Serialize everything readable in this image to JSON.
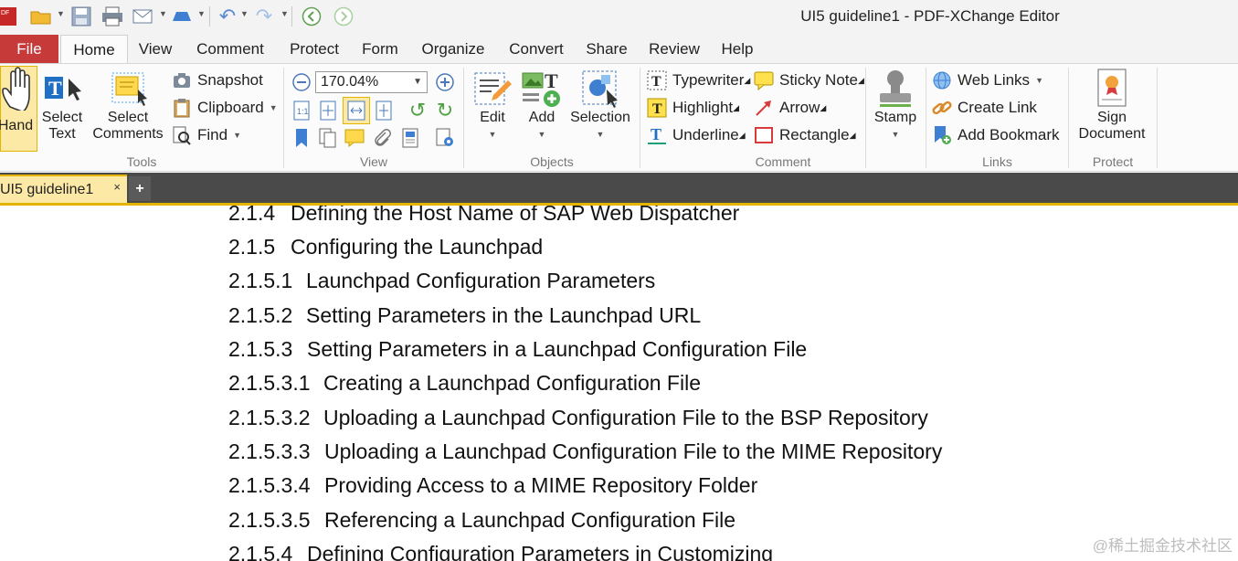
{
  "titlebar": {
    "title": "UI5 guideline1 - PDF-XChange Editor",
    "app_icon_text": "DF"
  },
  "tabs": [
    {
      "label": "File"
    },
    {
      "label": "Home"
    },
    {
      "label": "View"
    },
    {
      "label": "Comment"
    },
    {
      "label": "Protect"
    },
    {
      "label": "Form"
    },
    {
      "label": "Organize"
    },
    {
      "label": "Convert"
    },
    {
      "label": "Share"
    },
    {
      "label": "Review"
    },
    {
      "label": "Help"
    }
  ],
  "tools": {
    "hand": "Hand",
    "select_text_1": "Select",
    "select_text_2": "Text",
    "select_comments_1": "Select",
    "select_comments_2": "Comments",
    "snapshot": "Snapshot",
    "clipboard": "Clipboard",
    "find": "Find",
    "label": "Tools"
  },
  "view": {
    "zoom": "170.04%",
    "label": "View"
  },
  "objects": {
    "edit": "Edit",
    "add": "Add",
    "selection": "Selection",
    "label": "Objects"
  },
  "comment": {
    "typewriter": "Typewriter",
    "sticky_note": "Sticky Note",
    "highlight": "Highlight",
    "arrow": "Arrow",
    "underline": "Underline",
    "rectangle": "Rectangle",
    "stamp": "Stamp",
    "label": "Comment"
  },
  "links": {
    "web_links": "Web Links",
    "create_link": "Create Link",
    "add_bookmark": "Add Bookmark",
    "label": "Links"
  },
  "protect": {
    "sign_1": "Sign",
    "sign_2": "Document",
    "label": "Protect"
  },
  "doc_tab": {
    "label": "UI5 guideline1",
    "close": "×",
    "new_tab": "+"
  },
  "document": {
    "entries": [
      {
        "num": "2.1.4",
        "text": "Defining the Host Name of SAP Web Dispatcher"
      },
      {
        "num": "2.1.5",
        "text": "Configuring the Launchpad"
      },
      {
        "num": "2.1.5.1",
        "text": "Launchpad Configuration Parameters"
      },
      {
        "num": "2.1.5.2",
        "text": "Setting Parameters in the Launchpad URL"
      },
      {
        "num": "2.1.5.3",
        "text": "Setting Parameters in a Launchpad Configuration File"
      },
      {
        "num": "2.1.5.3.1",
        "text": "Creating a Launchpad Configuration File"
      },
      {
        "num": "2.1.5.3.2",
        "text": "Uploading a Launchpad Configuration File to the BSP Repository"
      },
      {
        "num": "2.1.5.3.3",
        "text": "Uploading a Launchpad Configuration File to the MIME Repository"
      },
      {
        "num": "2.1.5.3.4",
        "text": "Providing Access to a MIME Repository Folder"
      },
      {
        "num": "2.1.5.3.5",
        "text": "Referencing a Launchpad Configuration File"
      },
      {
        "num": "2.1.5.4",
        "text": "Defining Configuration Parameters in Customizing"
      }
    ],
    "watermark": "@稀土掘金技术社区"
  },
  "colors": {
    "file_tab": "#c63a3a",
    "doc_tab_accent": "#e3b500",
    "doc_bar": "#4a4a4a"
  }
}
